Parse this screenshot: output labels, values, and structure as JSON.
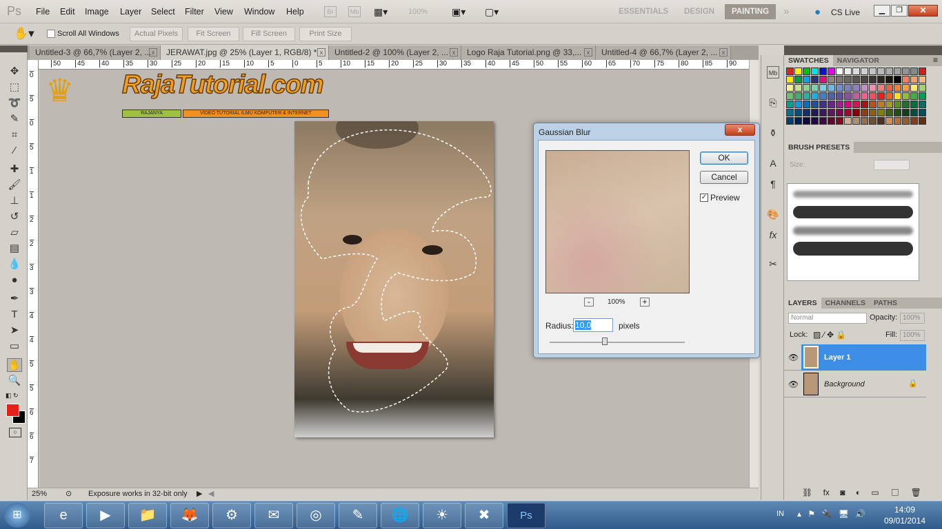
{
  "app": {
    "logo": "Ps",
    "menu": [
      "File",
      "Edit",
      "Image",
      "Layer",
      "Select",
      "Filter",
      "View",
      "Window",
      "Help"
    ],
    "appbar_icons": [
      "Br",
      "Mb"
    ],
    "zoom_select": "100%",
    "workspaces": [
      "ESSENTIALS",
      "DESIGN",
      "PAINTING"
    ],
    "active_workspace": "PAINTING",
    "cs_live": "CS Live"
  },
  "options": {
    "scroll_all_windows": "Scroll All Windows",
    "scroll_all_checked": false,
    "buttons": [
      "Actual Pixels",
      "Fit Screen",
      "Fill Screen",
      "Print Size"
    ]
  },
  "tabs": [
    {
      "label": "Untitled-3 @ 66,7% (Layer 2, ...",
      "active": false
    },
    {
      "label": "JERAWAT.jpg @ 25% (Layer 1, RGB/8) *",
      "active": true
    },
    {
      "label": "Untitled-2 @ 100% (Layer 2, ...",
      "active": false
    },
    {
      "label": "Logo Raja Tutorial.png @ 33,...",
      "active": false
    },
    {
      "label": "Untitled-4 @ 66,7% (Layer 2, ...",
      "active": false
    }
  ],
  "ruler": {
    "top": [
      "50",
      "45",
      "40",
      "35",
      "30",
      "25",
      "20",
      "15",
      "10",
      "5",
      "0",
      "5",
      "10",
      "15",
      "20",
      "25",
      "30",
      "35",
      "40",
      "45",
      "50",
      "55",
      "60",
      "65",
      "70",
      "75",
      "80",
      "85",
      "90"
    ],
    "left": [
      "0",
      "5",
      "0",
      "5",
      "1",
      "1",
      "2",
      "2",
      "3",
      "3",
      "4",
      "4",
      "5",
      "5",
      "6",
      "6",
      "7"
    ]
  },
  "logo": {
    "title": "RajaTutorial.com",
    "tag1": "RAJANYA",
    "tag2": "VIDEO TUTORIAL ILMU KOMPUTER & INTERNET"
  },
  "status": {
    "zoom": "25%",
    "message": "Exposure works in 32-bit only"
  },
  "colors": {
    "foreground": "#e8201c",
    "background": "#000000",
    "selection": "#3d8fe6"
  },
  "dialog": {
    "title": "Gaussian Blur",
    "ok": "OK",
    "cancel": "Cancel",
    "preview_label": "Preview",
    "preview_checked": true,
    "zoom": "100%",
    "zoom_minus": "-",
    "zoom_plus": "+",
    "radius_label": "Radius:",
    "radius_value": "10,0",
    "radius_unit": "pixels",
    "close": "x"
  },
  "panels": {
    "swatches_tabs": [
      "SWATCHES",
      "NAVIGATOR"
    ],
    "swatch_colors": [
      "#e8201c",
      "#fff200",
      "#00c000",
      "#00e0f0",
      "#0010e0",
      "#f000f0",
      "#ffffff",
      "#ececec",
      "#dcdcdc",
      "#d0d0d0",
      "#c4c4c4",
      "#b8b8b8",
      "#acacac",
      "#a0a0a0",
      "#949494",
      "#888888",
      "#e01818",
      "#f8e800",
      "#00a040",
      "#10a0e0",
      "#303080",
      "#e01080",
      "#8c8680",
      "#7c7670",
      "#6c6660",
      "#5c5650",
      "#4c4640",
      "#3c3630",
      "#2c2620",
      "#1c1610",
      "#000000",
      "#f08060",
      "#f0a070",
      "#f4b880",
      "#f8f090",
      "#c8e090",
      "#90d090",
      "#80d0b0",
      "#80d0e0",
      "#70b8e8",
      "#7090d0",
      "#8080c0",
      "#9080c0",
      "#c090c0",
      "#f090b0",
      "#f08080",
      "#f06040",
      "#f08040",
      "#f0a040",
      "#f8f060",
      "#a8d070",
      "#70c070",
      "#40b070",
      "#30b0a0",
      "#20b0e0",
      "#4080c8",
      "#5060b0",
      "#6050a0",
      "#9050a0",
      "#c060a0",
      "#f06090",
      "#f05060",
      "#e82020",
      "#f06020",
      "#f8e020",
      "#90c030",
      "#40b040",
      "#00a050",
      "#00a090",
      "#00a0e0",
      "#0070c0",
      "#2050a0",
      "#403090",
      "#702090",
      "#a02090",
      "#e00080",
      "#e01050",
      "#b01010",
      "#c05010",
      "#c08010",
      "#a0a010",
      "#609020",
      "#207030",
      "#007040",
      "#007060",
      "#007090",
      "#005080",
      "#103070",
      "#201860",
      "#401860",
      "#601860",
      "#800850",
      "#a00830",
      "#900000",
      "#904010",
      "#906010",
      "#808000",
      "#406010",
      "#205010",
      "#104020",
      "#005040",
      "#005060",
      "#004070",
      "#002050",
      "#100840",
      "#200840",
      "#400840",
      "#600830",
      "#800820",
      "#d0b090",
      "#b09070",
      "#907050",
      "#705030",
      "#503020",
      "#d09060",
      "#b07040",
      "#906030",
      "#804020",
      "#603010"
    ],
    "brush_presets": "BRUSH PRESETS",
    "size_label": "Size:",
    "layers_tabs": [
      "LAYERS",
      "CHANNELS",
      "PATHS"
    ],
    "blend_mode": "Normal",
    "opacity_label": "Opacity:",
    "opacity": "100%",
    "lock_label": "Lock:",
    "fill_label": "Fill:",
    "fill": "100%",
    "layers": [
      {
        "name": "Layer 1",
        "visible": true,
        "selected": true
      },
      {
        "name": "Background",
        "visible": true,
        "selected": false,
        "locked": true
      }
    ]
  },
  "taskbar": {
    "apps": [
      "internet-explorer",
      "media-player",
      "file-explorer",
      "firefox",
      "app-5",
      "app-6",
      "chrome",
      "notepad",
      "globe",
      "app-10",
      "xampp",
      "photoshop"
    ],
    "photoshop_label": "Ps",
    "lang": "IN",
    "time": "14:09",
    "date": "09/01/2014"
  }
}
